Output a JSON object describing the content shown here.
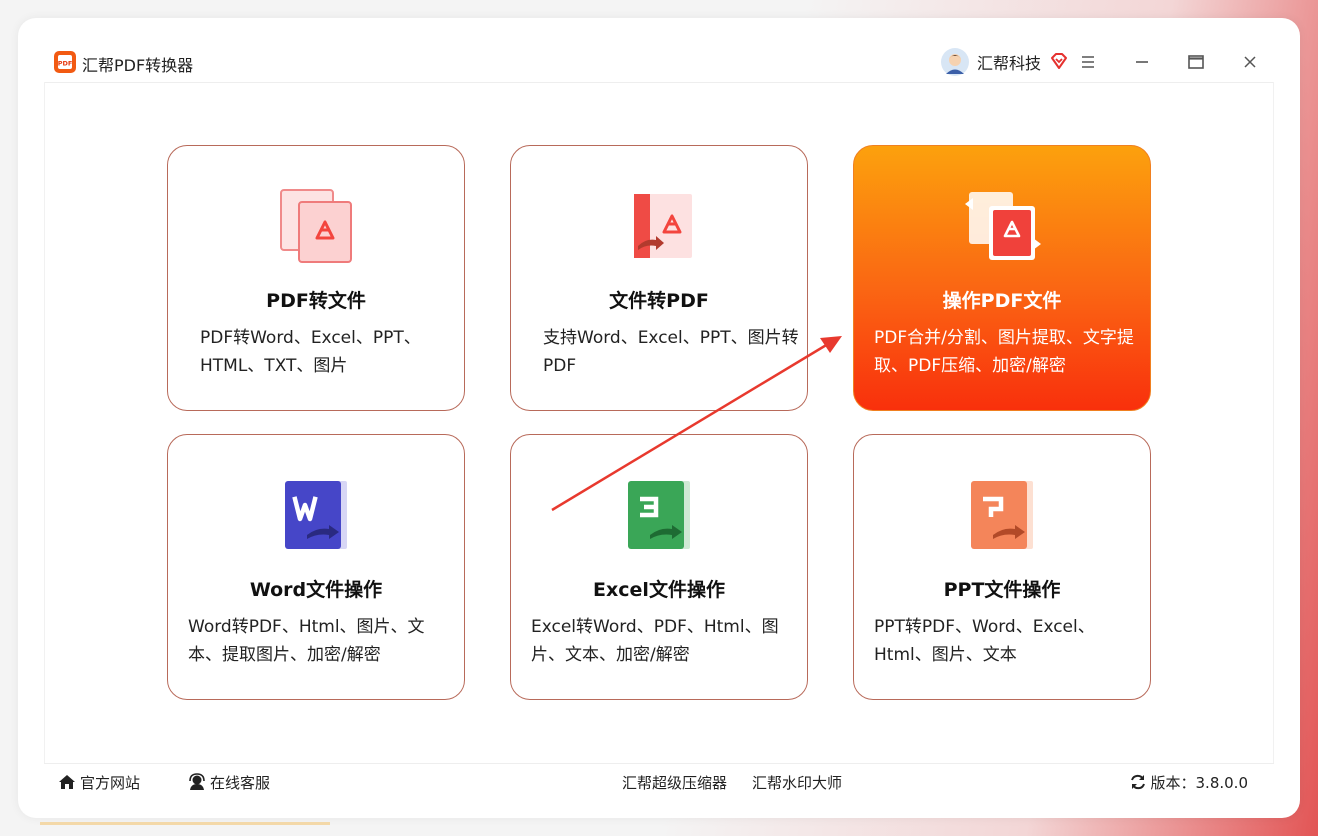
{
  "app": {
    "title": "汇帮PDF转换器",
    "logo_icon": "pdf-logo-icon",
    "user_name": "汇帮科技",
    "accent_color": "#f85a10"
  },
  "cards": [
    {
      "title": "PDF转文件",
      "desc": "PDF转Word、Excel、PPT、HTML、TXT、图片",
      "icon": "pdf-to-file-icon",
      "active": false
    },
    {
      "title": "文件转PDF",
      "desc": "支持Word、Excel、PPT、图片转PDF",
      "icon": "file-to-pdf-icon",
      "active": false
    },
    {
      "title": "操作PDF文件",
      "desc": "PDF合并/分割、图片提取、文字提取、PDF压缩、加密/解密",
      "icon": "pdf-operate-icon",
      "active": true
    },
    {
      "title": "Word文件操作",
      "desc": "Word转PDF、Html、图片、文本、提取图片、加密/解密",
      "icon": "word-icon",
      "active": false
    },
    {
      "title": "Excel文件操作",
      "desc": "Excel转Word、PDF、Html、图片、文本、加密/解密",
      "icon": "excel-icon",
      "active": false
    },
    {
      "title": "PPT文件操作",
      "desc": "PPT转PDF、Word、Excel、Html、图片、文本",
      "icon": "ppt-icon",
      "active": false
    }
  ],
  "footer": {
    "official_site": "官方网站",
    "online_service": "在线客服",
    "compressor": "汇帮超级压缩器",
    "watermark": "汇帮水印大师",
    "version": "版本：3.8.0.0"
  }
}
